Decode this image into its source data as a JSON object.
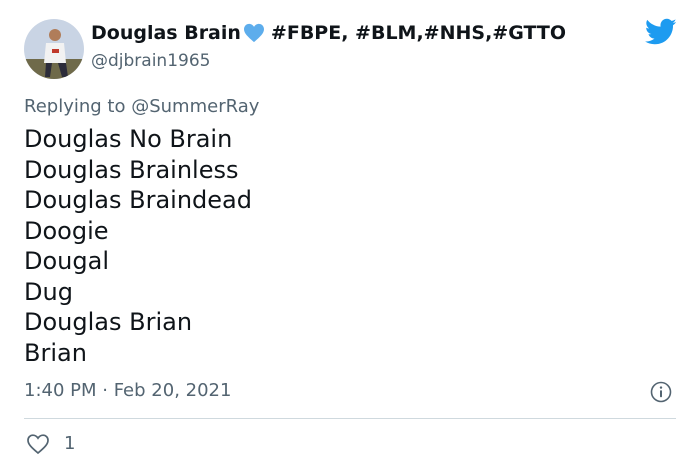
{
  "tweet": {
    "author": {
      "display_name": "Douglas Brain",
      "name_suffix": "#FBPE, #BLM,#NHS,#GTTO",
      "handle": "@djbrain1965",
      "avatar_icon": "profile-photo-runner",
      "name_emoji": "blue-heart-icon"
    },
    "replying_to": {
      "prefix": "Replying to",
      "mention": "@SummerRay"
    },
    "lines": [
      "Douglas No Brain",
      "Douglas Brainless",
      "Douglas Braindead",
      "Doogie",
      "Dougal",
      "Dug",
      "Douglas Brian",
      "Brian"
    ],
    "timestamp": "1:40 PM · Feb 20, 2021",
    "likes": "1"
  },
  "colors": {
    "text": "#0f1419",
    "secondary": "#536471",
    "twitter_blue": "#1d9bf0",
    "heart": "#5dadec",
    "divider": "#cfd9de"
  }
}
